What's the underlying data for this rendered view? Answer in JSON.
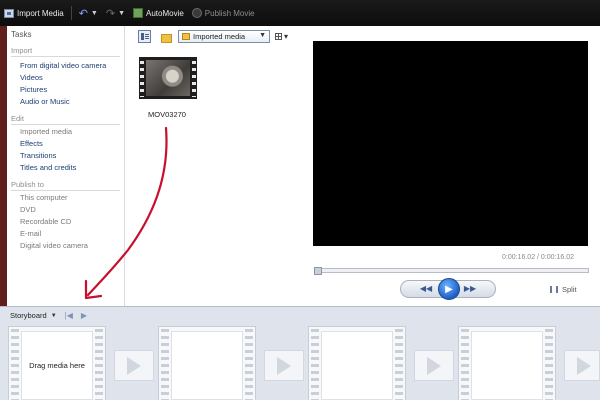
{
  "toolbar": {
    "import_media": "Import Media",
    "automovie": "AutoMovie",
    "publish_movie": "Publish Movie"
  },
  "tasks": {
    "title": "Tasks",
    "import": {
      "heading": "Import",
      "items": [
        "From digital video camera",
        "Videos",
        "Pictures",
        "Audio or Music"
      ]
    },
    "edit": {
      "heading": "Edit",
      "items": [
        "Imported media",
        "Effects",
        "Transitions",
        "Titles and credits"
      ]
    },
    "publish": {
      "heading": "Publish to",
      "items": [
        "This computer",
        "DVD",
        "Recordable CD",
        "E-mail",
        "Digital video camera"
      ]
    }
  },
  "collection": {
    "selected": "Imported media",
    "clip_name": "MOV03270"
  },
  "preview": {
    "time": "0:00:16.02 / 0:00:16.02",
    "split_label": "Split"
  },
  "storyboard": {
    "label": "Storyboard",
    "drop_hint": "Drag media here"
  },
  "colors": {
    "annotation": "#c8102e",
    "link": "#1e3d73",
    "play_button": "#1d5fc7"
  }
}
